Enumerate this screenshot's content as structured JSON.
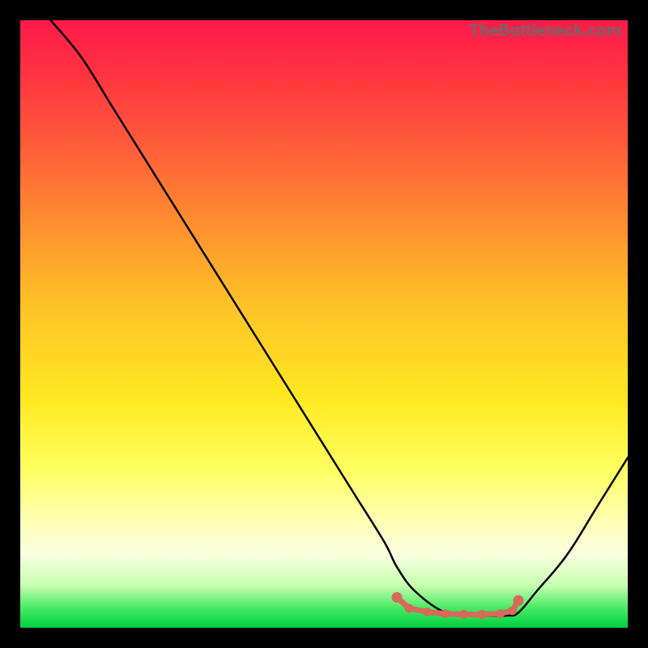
{
  "watermark": "TheBottleneck.com",
  "chart_data": {
    "type": "line",
    "title": "",
    "xlabel": "",
    "ylabel": "",
    "xlim": [
      0,
      100
    ],
    "ylim": [
      0,
      100
    ],
    "series": [
      {
        "name": "curve",
        "x": [
          5,
          10,
          15,
          20,
          25,
          30,
          35,
          40,
          45,
          50,
          55,
          60,
          62,
          65,
          70,
          75,
          80,
          82,
          85,
          90,
          95,
          100
        ],
        "y": [
          100,
          94,
          86,
          78,
          70,
          62,
          54,
          46,
          38,
          30,
          22,
          14,
          10,
          6,
          2.5,
          2,
          2,
          2.5,
          6,
          12,
          20,
          28
        ]
      }
    ],
    "markers": {
      "name": "bottom-markers",
      "x": [
        62,
        64,
        67,
        70,
        73,
        76,
        79,
        81,
        82
      ],
      "y": [
        5,
        3.2,
        2.6,
        2.3,
        2.2,
        2.2,
        2.3,
        2.8,
        4.5
      ]
    },
    "colors": {
      "curve": "#000000",
      "marker": "#d86a5a"
    }
  }
}
